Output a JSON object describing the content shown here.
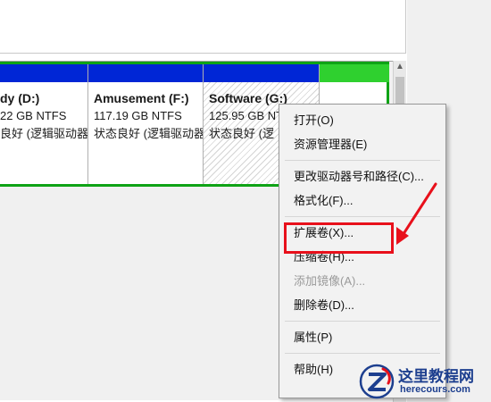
{
  "partitions": [
    {
      "name": "dy (D:)",
      "size": "22 GB NTFS",
      "status": "良好 (逻辑驱动器)"
    },
    {
      "name": "Amusement (F:)",
      "size": "117.19 GB NTFS",
      "status": "状态良好 (逻辑驱动器)"
    },
    {
      "name": "Software (G:)",
      "size": "125.95 GB NTFS",
      "status": "状态良好 (逻"
    },
    {
      "name": "",
      "size": "",
      "status": ""
    }
  ],
  "context_menu": {
    "items": [
      {
        "label": "打开(O)",
        "enabled": true
      },
      {
        "label": "资源管理器(E)",
        "enabled": true
      },
      {
        "label": "更改驱动器号和路径(C)...",
        "enabled": true
      },
      {
        "label": "格式化(F)...",
        "enabled": true
      },
      {
        "label": "扩展卷(X)...",
        "enabled": true,
        "highlighted": true
      },
      {
        "label": "压缩卷(H)...",
        "enabled": true
      },
      {
        "label": "添加镜像(A)...",
        "enabled": false
      },
      {
        "label": "删除卷(D)...",
        "enabled": true
      },
      {
        "label": "属性(P)",
        "enabled": true
      },
      {
        "label": "帮助(H)",
        "enabled": true
      }
    ]
  },
  "scrollbar": {
    "up_arrow": "▲"
  },
  "watermark": {
    "title": "这里教程网",
    "url": "herecours.com"
  },
  "colors": {
    "primary_partition_bar": "#0026d6",
    "free_space_bar": "#2fd02f",
    "selection_border": "#0fa316",
    "highlight_box": "#e8101b"
  }
}
